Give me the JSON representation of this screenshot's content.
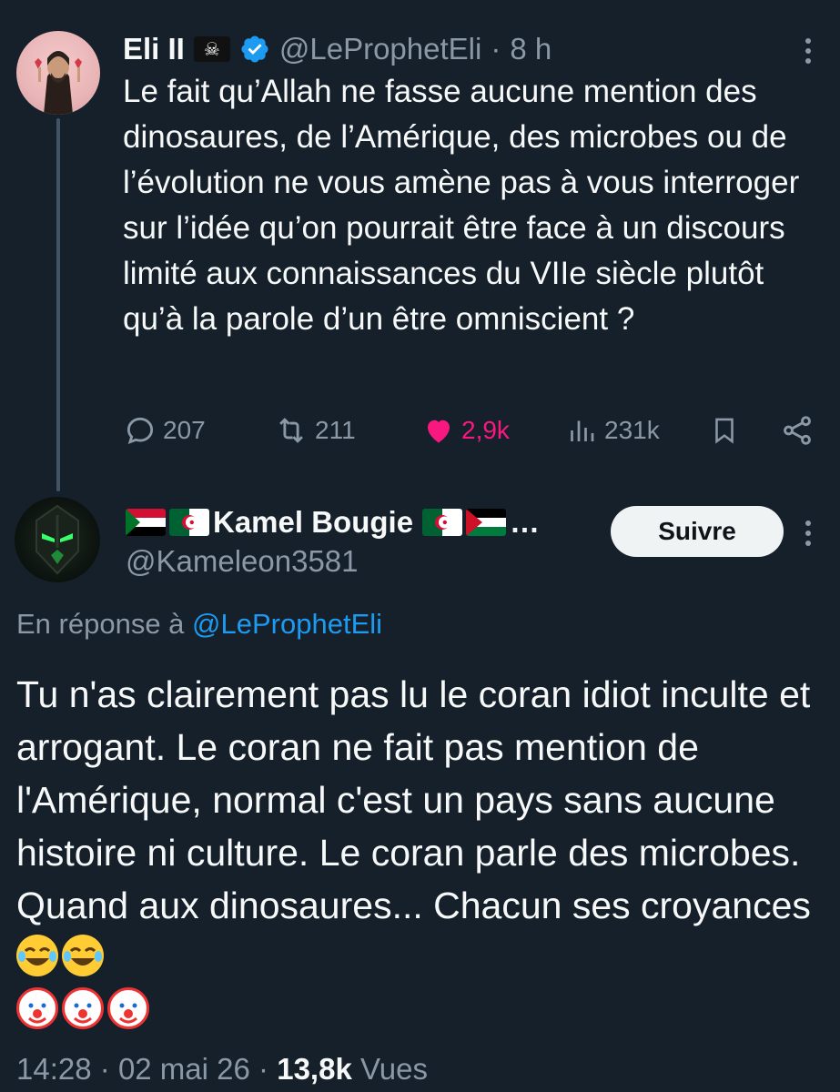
{
  "tweet1": {
    "name": "Eli II",
    "flag_icon": "pirate-flag",
    "handle": "@LeProphetEli",
    "time_sep": "·",
    "time": "8 h",
    "text": "Le fait qu’Allah ne fasse aucune mention des dinosaures, de l’Amérique, des microbes ou de l’évolution ne vous amène pas à vous interroger sur l’idée qu’on pourrait être face à un discours limité aux connaissances du VIIe siècle plutôt qu’à la parole d’un être omniscient ?",
    "actions": {
      "replies": "207",
      "retweets": "211",
      "likes": "2,9k",
      "views": "231k"
    },
    "colors": {
      "like": "#f91880",
      "verified": "#1d9bf0"
    }
  },
  "tweet2": {
    "name": "Kamel Bougie",
    "name_suffix": "…",
    "handle": "@Kameleon3581",
    "follow_label": "Suivre",
    "reply_prefix": "En réponse à",
    "reply_to": "@LeProphetEli",
    "text": "Tu n'as clairement pas lu le coran idiot inculte et arrogant. Le coran ne fait pas mention de l'Amérique, normal c'est un pays sans aucune histoire ni culture. Le coran parle des microbes. Quand aux dinosaures... Chacun ses croyances",
    "emoji_laugh": [
      "face-with-tears-of-joy",
      "face-with-tears-of-joy"
    ],
    "emoji_clown": [
      "clown-face",
      "clown-face",
      "clown-face"
    ],
    "time": "14:28",
    "date": "02 mai 26",
    "views": "13,8k",
    "views_label": "Vues",
    "sep": "·"
  }
}
